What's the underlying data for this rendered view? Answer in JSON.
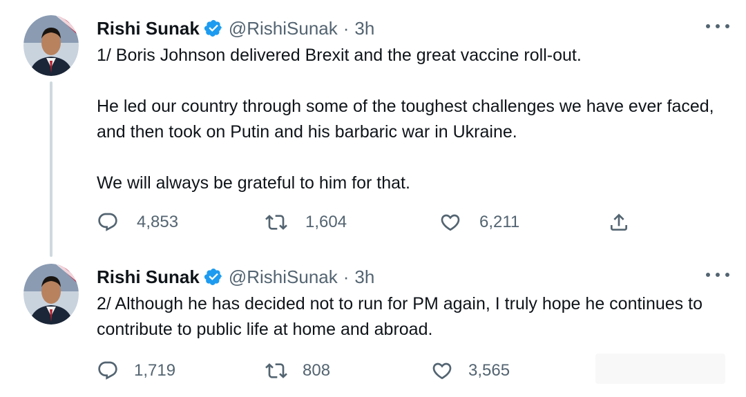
{
  "tweets": [
    {
      "name": "Rishi Sunak",
      "handle": "@RishiSunak",
      "separator": "·",
      "time": "3h",
      "paragraphs": [
        "1/ Boris Johnson delivered Brexit and the great vaccine roll-out.",
        "He led our country through some of the toughest challenges we have ever faced, and then took on Putin and his barbaric war in Ukraine.",
        "We will always be grateful to him for that."
      ],
      "replies": "4,853",
      "retweets": "1,604",
      "likes": "6,211"
    },
    {
      "name": "Rishi Sunak",
      "handle": "@RishiSunak",
      "separator": "·",
      "time": "3h",
      "paragraphs": [
        "2/ Although he has decided not to run for PM again, I truly hope he continues to contribute to public life at home and abroad."
      ],
      "replies": "1,719",
      "retweets": "808",
      "likes": "3,565"
    }
  ],
  "icons": {
    "verified": "verified-badge-icon",
    "more": "more-options-icon",
    "reply": "reply-icon",
    "retweet": "retweet-icon",
    "like": "heart-icon",
    "share": "share-icon"
  },
  "colors": {
    "verified_blue": "#1d9bf0",
    "secondary_text": "#536471",
    "primary_text": "#0f1419",
    "thread_line": "#cfd9de"
  }
}
